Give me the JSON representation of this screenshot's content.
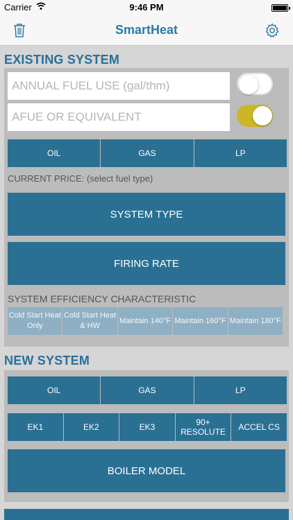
{
  "status_bar": {
    "carrier": "Carrier",
    "time": "9:46 PM",
    "battery_level": 1.0
  },
  "nav": {
    "title": "SmartHeat",
    "left_icon": "trash-icon",
    "right_icon": "gear-icon",
    "accent": "#2a7ba8"
  },
  "existing_system": {
    "heading": "EXISTING SYSTEM",
    "annual_fuel_placeholder": "ANNUAL FUEL USE (gal/thm)",
    "annual_fuel_toggle": false,
    "afue_placeholder": "AFUE OR EQUIVALENT",
    "afue_toggle": true,
    "fuel_types": [
      "OIL",
      "GAS",
      "LP"
    ],
    "current_price_label": "CURRENT PRICE: (select fuel type)",
    "system_type_label": "SYSTEM TYPE",
    "firing_rate_label": "FIRING RATE",
    "efficiency_label": "SYSTEM EFFICIENCY CHARACTERISTIC",
    "efficiency_options": [
      "Cold Start Heat Only",
      "Cold Start Heat & HW",
      "Maintain 140°F",
      "Maintain 160°F",
      "Maintain 180°F"
    ]
  },
  "new_system": {
    "heading": "NEW SYSTEM",
    "fuel_types": [
      "OIL",
      "GAS",
      "LP"
    ],
    "models": [
      "EK1",
      "EK2",
      "EK3",
      "90+ RESOLUTE",
      "ACCEL CS"
    ],
    "boiler_model_label": "BOILER MODEL"
  },
  "colors": {
    "button_blue": "#2a7093",
    "toggle_on": "#ccb627",
    "panel": "#bcbcbc"
  }
}
